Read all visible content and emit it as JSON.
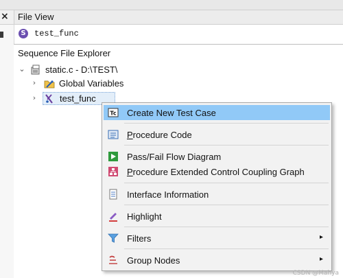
{
  "top_left_close": "×",
  "panel": {
    "title": "File View"
  },
  "function_row": {
    "icon_letter": "S",
    "name": "test_func"
  },
  "explorer": {
    "title": "Sequence File Explorer",
    "tree": [
      {
        "label": "static.c - D:\\TEST\\",
        "icon": "source-file-icon",
        "expanded": true
      },
      {
        "label": "Global Variables",
        "icon": "global-variables-folder-icon",
        "expanded": false
      },
      {
        "label": "test_func",
        "icon": "function-icon",
        "expanded": false,
        "selected": true
      }
    ]
  },
  "context_menu": {
    "items": [
      {
        "label": "Create New Test Case",
        "mnemonic_prefix": "",
        "mnemonic": "",
        "rest": "Create New Test Case",
        "icon": "test-case-icon",
        "highlighted": true
      },
      {
        "label": "Procedure Code",
        "mnemonic_prefix": "",
        "mnemonic": "P",
        "rest": "rocedure Code",
        "icon": "procedure-code-icon"
      },
      {
        "label": "Pass/Fail Flow Diagram",
        "mnemonic_prefix": "",
        "mnemonic": "",
        "rest": "Pass/Fail Flow Diagram",
        "icon": "flow-diagram-icon"
      },
      {
        "label": "Procedure Extended Control Coupling Graph",
        "mnemonic_prefix": "",
        "mnemonic": "P",
        "rest": "rocedure Extended Control Coupling Graph",
        "icon": "coupling-graph-icon"
      },
      {
        "label": "Interface Information",
        "mnemonic_prefix": "",
        "mnemonic": "",
        "rest": "Interface Information",
        "icon": "interface-info-icon"
      },
      {
        "label": "Highlight",
        "mnemonic_prefix": "",
        "mnemonic": "",
        "rest": "Highlight",
        "icon": "highlight-pen-icon"
      },
      {
        "label": "Filters",
        "mnemonic_prefix": "",
        "mnemonic": "",
        "rest": "Filters",
        "icon": "filter-funnel-icon",
        "submenu": "▸"
      },
      {
        "label": "Group Nodes",
        "mnemonic_prefix": "",
        "mnemonic": "",
        "rest": "Group Nodes",
        "icon": "group-nodes-icon",
        "submenu": "▸"
      }
    ]
  },
  "watermark": "CSDN @Mahya"
}
